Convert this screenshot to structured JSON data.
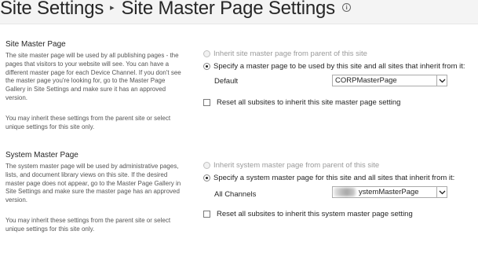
{
  "header": {
    "breadcrumb_parent": "Site Settings",
    "separator": "▸",
    "page_title": "Site Master Page Settings",
    "info_icon": "i"
  },
  "site_master": {
    "title": "Site Master Page",
    "description": "The site master page will be used by all publishing pages - the pages that visitors to your website will see. You can have a different master page for each Device Channel. If you don't see the master page you're looking for, go to the Master Page Gallery in Site Settings and make sure it has an approved version.",
    "note": "You may inherit these settings from the parent site or select unique settings for this site only.",
    "inherit_label": "Inherit site master page from parent of this site",
    "specify_label": "Specify a master page to be used by this site and all sites that inherit from it:",
    "channel_label": "Default",
    "selected_value": "CORPMasterPage",
    "reset_label": "Reset all subsites to inherit this site master page setting",
    "selected_option": "specify",
    "reset_checked": false
  },
  "system_master": {
    "title": "System Master Page",
    "description": "The system master page will be used by administrative pages, lists, and document library views on this site. If the desired master page does not appear, go to the Master Page Gallery in Site Settings and make sure the master page has an approved version.",
    "note": "You may inherit these settings from the parent site or select unique settings for this site only.",
    "inherit_label": "Inherit system master page from parent of this site",
    "specify_label": "Specify a system master page for this site and all sites that inherit from it:",
    "channel_label": "All Channels",
    "selected_value": "ystemMasterPage",
    "reset_label": "Reset all subsites to inherit this system master page setting",
    "selected_option": "specify",
    "reset_checked": false
  },
  "icons": {
    "dropdown": "chevron-down-icon",
    "info": "info-icon",
    "radio": "radio-button",
    "checkbox": "checkbox"
  }
}
